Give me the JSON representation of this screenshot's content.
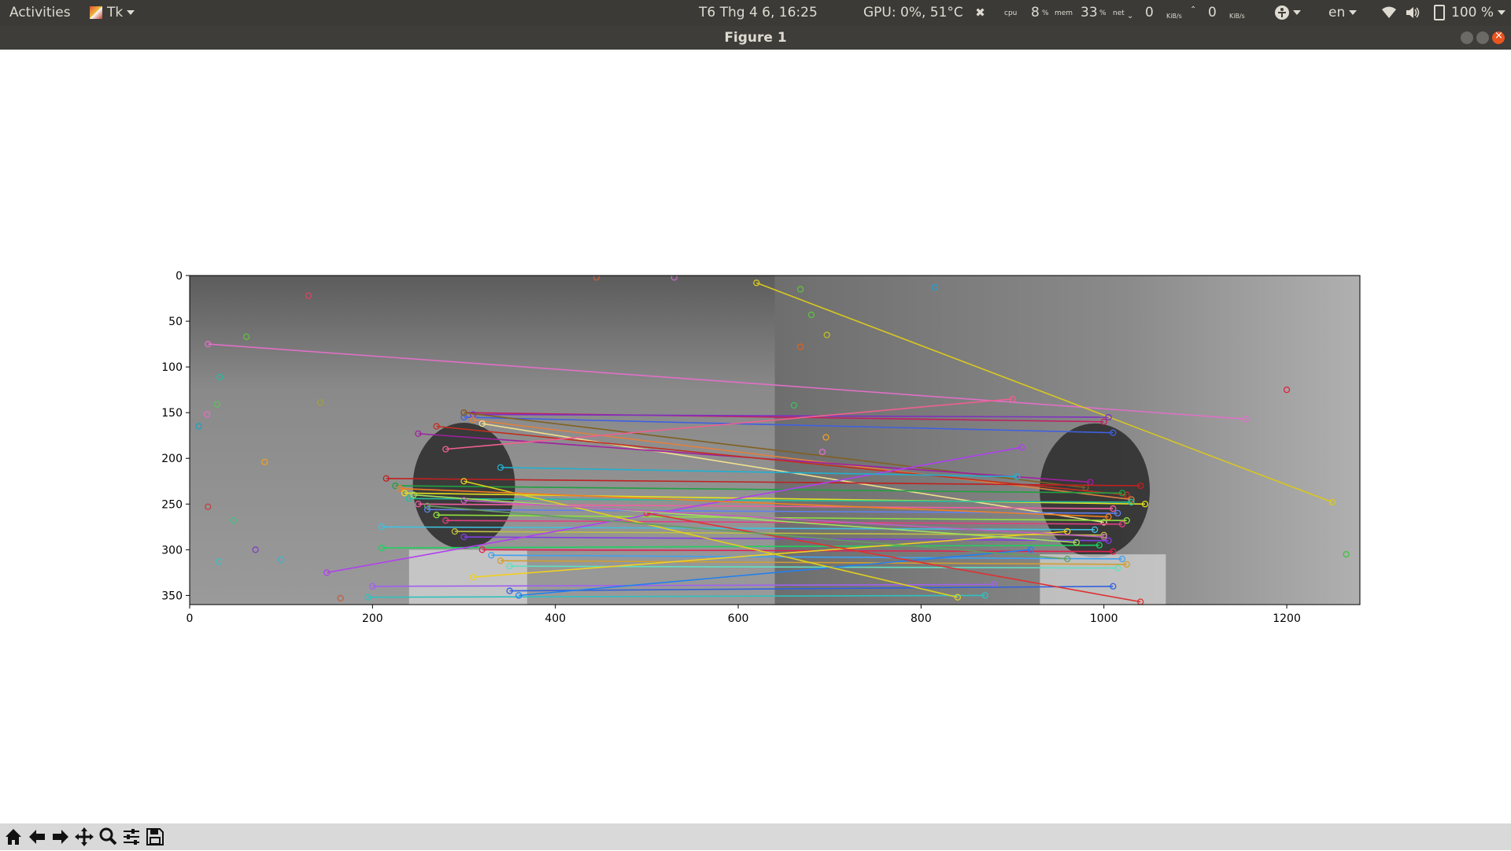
{
  "topbar": {
    "activities": "Activities",
    "app_menu": "Tk",
    "clock": "T6 Thg 4  6, 16:25",
    "gpu": "GPU: 0%, 51°C",
    "cpu_label": "cpu",
    "cpu_value": "8",
    "cpu_unit": "%",
    "mem_label": "mem",
    "mem_value": "33",
    "mem_unit": "%",
    "net_label": "net",
    "net_down": "0",
    "net_down_unit": "KiB/s",
    "net_up": "0",
    "net_up_unit": "KiB/s",
    "lang": "en",
    "battery": "100 %"
  },
  "window": {
    "title": "Figure 1"
  },
  "toolbar": {
    "buttons": [
      "home",
      "back",
      "forward",
      "pan",
      "zoom",
      "configure-subplots",
      "save"
    ]
  },
  "chart_data": {
    "type": "image",
    "description_note": "",
    "xlim": [
      0,
      1280
    ],
    "ylim": [
      360,
      0
    ],
    "x_ticks": [
      0,
      200,
      400,
      600,
      800,
      1000,
      1200
    ],
    "y_ticks": [
      0,
      50,
      100,
      150,
      200,
      250,
      300,
      350
    ],
    "image_split_x": 640,
    "lines": [
      {
        "x1": 20,
        "y1": 75,
        "x2": 1155,
        "y2": 157,
        "color": "#e070c8"
      },
      {
        "x1": 620,
        "y1": 8,
        "x2": 1250,
        "y2": 248,
        "color": "#d8c820"
      },
      {
        "x1": 300,
        "y1": 150,
        "x2": 1000,
        "y2": 160,
        "color": "#c02060"
      },
      {
        "x1": 310,
        "y1": 152,
        "x2": 1005,
        "y2": 155,
        "color": "#8030c0"
      },
      {
        "x1": 300,
        "y1": 155,
        "x2": 1010,
        "y2": 172,
        "color": "#4060e0"
      },
      {
        "x1": 310,
        "y1": 158,
        "x2": 1030,
        "y2": 245,
        "color": "#e08040"
      },
      {
        "x1": 320,
        "y1": 162,
        "x2": 1000,
        "y2": 270,
        "color": "#f0e090"
      },
      {
        "x1": 300,
        "y1": 150,
        "x2": 980,
        "y2": 232,
        "color": "#806020"
      },
      {
        "x1": 250,
        "y1": 173,
        "x2": 985,
        "y2": 226,
        "color": "#a020a0"
      },
      {
        "x1": 270,
        "y1": 165,
        "x2": 1025,
        "y2": 240,
        "color": "#c03020"
      },
      {
        "x1": 215,
        "y1": 222,
        "x2": 1040,
        "y2": 230,
        "color": "#c02020"
      },
      {
        "x1": 225,
        "y1": 230,
        "x2": 1020,
        "y2": 238,
        "color": "#20a040"
      },
      {
        "x1": 235,
        "y1": 238,
        "x2": 1045,
        "y2": 250,
        "color": "#e0e020"
      },
      {
        "x1": 240,
        "y1": 244,
        "x2": 1030,
        "y2": 248,
        "color": "#20c0a0"
      },
      {
        "x1": 250,
        "y1": 250,
        "x2": 1010,
        "y2": 255,
        "color": "#f060a0"
      },
      {
        "x1": 260,
        "y1": 256,
        "x2": 1015,
        "y2": 260,
        "color": "#6080f0"
      },
      {
        "x1": 270,
        "y1": 262,
        "x2": 1025,
        "y2": 268,
        "color": "#90e040"
      },
      {
        "x1": 280,
        "y1": 268,
        "x2": 1020,
        "y2": 272,
        "color": "#e04080"
      },
      {
        "x1": 210,
        "y1": 275,
        "x2": 990,
        "y2": 278,
        "color": "#40c0e0"
      },
      {
        "x1": 290,
        "y1": 280,
        "x2": 1000,
        "y2": 284,
        "color": "#c0c040"
      },
      {
        "x1": 300,
        "y1": 286,
        "x2": 1005,
        "y2": 290,
        "color": "#8040e0"
      },
      {
        "x1": 210,
        "y1": 298,
        "x2": 995,
        "y2": 295,
        "color": "#20d060"
      },
      {
        "x1": 320,
        "y1": 300,
        "x2": 1010,
        "y2": 302,
        "color": "#e02050"
      },
      {
        "x1": 330,
        "y1": 306,
        "x2": 1020,
        "y2": 310,
        "color": "#40a0f0"
      },
      {
        "x1": 340,
        "y1": 312,
        "x2": 1025,
        "y2": 316,
        "color": "#d0a030"
      },
      {
        "x1": 350,
        "y1": 318,
        "x2": 1015,
        "y2": 320,
        "color": "#60e0c0"
      },
      {
        "x1": 150,
        "y1": 325,
        "x2": 910,
        "y2": 188,
        "color": "#b040f0"
      },
      {
        "x1": 310,
        "y1": 330,
        "x2": 960,
        "y2": 280,
        "color": "#f0d020"
      },
      {
        "x1": 200,
        "y1": 340,
        "x2": 880,
        "y2": 338,
        "color": "#a060f0"
      },
      {
        "x1": 195,
        "y1": 352,
        "x2": 870,
        "y2": 350,
        "color": "#30c0c0"
      },
      {
        "x1": 350,
        "y1": 345,
        "x2": 1010,
        "y2": 340,
        "color": "#3060e0"
      },
      {
        "x1": 360,
        "y1": 350,
        "x2": 920,
        "y2": 300,
        "color": "#2080f0"
      },
      {
        "x1": 300,
        "y1": 225,
        "x2": 840,
        "y2": 352,
        "color": "#e0d020"
      },
      {
        "x1": 500,
        "y1": 260,
        "x2": 1040,
        "y2": 357,
        "color": "#e03030"
      },
      {
        "x1": 280,
        "y1": 190,
        "x2": 900,
        "y2": 135,
        "color": "#f06090"
      },
      {
        "x1": 340,
        "y1": 210,
        "x2": 905,
        "y2": 220,
        "color": "#20b0d0"
      },
      {
        "x1": 230,
        "y1": 233,
        "x2": 1005,
        "y2": 264,
        "color": "#f08020"
      },
      {
        "x1": 245,
        "y1": 240,
        "x2": 970,
        "y2": 292,
        "color": "#a0e060"
      },
      {
        "x1": 300,
        "y1": 246,
        "x2": 1000,
        "y2": 286,
        "color": "#c060c0"
      },
      {
        "x1": 260,
        "y1": 252,
        "x2": 960,
        "y2": 310,
        "color": "#60a060"
      }
    ],
    "points": [
      {
        "x": 130,
        "y": 22,
        "color": "#e04060"
      },
      {
        "x": 62,
        "y": 67,
        "color": "#60c040"
      },
      {
        "x": 33,
        "y": 111,
        "color": "#20c0a0"
      },
      {
        "x": 19,
        "y": 152,
        "color": "#e070c8"
      },
      {
        "x": 10,
        "y": 165,
        "color": "#20a0c0"
      },
      {
        "x": 30,
        "y": 141,
        "color": "#60c060"
      },
      {
        "x": 143,
        "y": 139,
        "color": "#a0a040"
      },
      {
        "x": 82,
        "y": 204,
        "color": "#f0a020"
      },
      {
        "x": 20,
        "y": 253,
        "color": "#c04040"
      },
      {
        "x": 48,
        "y": 268,
        "color": "#40c080"
      },
      {
        "x": 72,
        "y": 300,
        "color": "#8040c0"
      },
      {
        "x": 100,
        "y": 311,
        "color": "#40b0d0"
      },
      {
        "x": 32,
        "y": 313,
        "color": "#40c0c0"
      },
      {
        "x": 165,
        "y": 353,
        "color": "#c06040"
      },
      {
        "x": 668,
        "y": 15,
        "color": "#60c040"
      },
      {
        "x": 815,
        "y": 13,
        "color": "#20a0d0"
      },
      {
        "x": 680,
        "y": 43,
        "color": "#60c040"
      },
      {
        "x": 697,
        "y": 65,
        "color": "#c0c020"
      },
      {
        "x": 668,
        "y": 78,
        "color": "#e06020"
      },
      {
        "x": 1200,
        "y": 125,
        "color": "#e02040"
      },
      {
        "x": 661,
        "y": 142,
        "color": "#40c060"
      },
      {
        "x": 696,
        "y": 177,
        "color": "#f0a020"
      },
      {
        "x": 692,
        "y": 193,
        "color": "#e070c8"
      },
      {
        "x": 1265,
        "y": 305,
        "color": "#40c040"
      },
      {
        "x": 530,
        "y": 2,
        "color": "#c070c0"
      },
      {
        "x": 445,
        "y": 2,
        "color": "#c06040"
      }
    ]
  }
}
